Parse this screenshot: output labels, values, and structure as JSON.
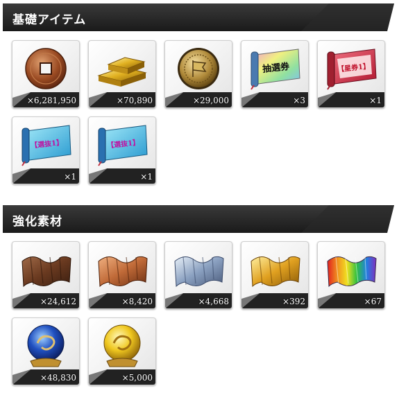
{
  "sections": [
    {
      "title": "基礎アイテム",
      "items": [
        {
          "icon": "coin-icon",
          "count": "×6,281,950"
        },
        {
          "icon": "gold-bars-icon",
          "count": "×70,890"
        },
        {
          "icon": "gold-medal-icon",
          "count": "×29,000"
        },
        {
          "icon": "lottery-ticket-scroll-icon",
          "count": "×3",
          "label": "抽選券"
        },
        {
          "icon": "red-scroll-icon",
          "count": "×1",
          "label": "【星券1】"
        },
        {
          "icon": "blue-scroll-icon",
          "count": "×1",
          "label": "【選抜1】"
        },
        {
          "icon": "blue-scroll-icon",
          "count": "×1",
          "label": "【選抜1】"
        }
      ]
    },
    {
      "title": "強化素材",
      "items": [
        {
          "icon": "brown-cloth-icon",
          "count": "×24,612"
        },
        {
          "icon": "bronze-cloth-icon",
          "count": "×8,420"
        },
        {
          "icon": "silver-cloth-icon",
          "count": "×4,668"
        },
        {
          "icon": "gold-cloth-icon",
          "count": "×392"
        },
        {
          "icon": "rainbow-cloth-icon",
          "count": "×67"
        },
        {
          "icon": "blue-dragon-orb-icon",
          "count": "×48,830"
        },
        {
          "icon": "gold-dragon-orb-icon",
          "count": "×5,000"
        }
      ]
    }
  ],
  "colors": {
    "header_bg": "#2b2b2b",
    "band_dark": "#222222",
    "band_light": "#6a6a6a"
  }
}
